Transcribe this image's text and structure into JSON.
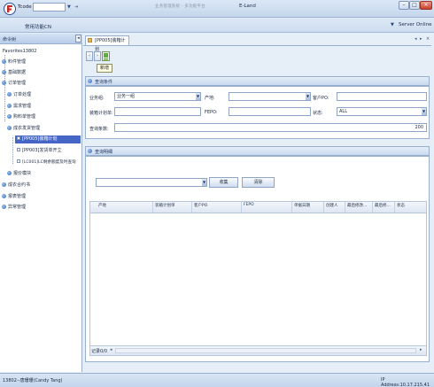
{
  "titlebar": {
    "tcode_label": "Tcode",
    "blurred_title": "业务管理系统 - 多功能平台",
    "app_title": "E-Land",
    "min": "–",
    "max": "□",
    "close": "×"
  },
  "menubar": {
    "favorites_menu": "常用功能CN",
    "server": "Server Online"
  },
  "sidebar": {
    "header": "命令树",
    "items": [
      {
        "label": "Favorites13802",
        "level": 0,
        "icon": "none"
      },
      {
        "label": "料件管理",
        "level": 0,
        "icon": "dot"
      },
      {
        "label": "基础数据",
        "level": 0,
        "icon": "dot"
      },
      {
        "label": "订单管理",
        "level": 0,
        "icon": "dot"
      },
      {
        "label": "订单处理",
        "level": 1,
        "icon": "dot"
      },
      {
        "label": "需求管理",
        "level": 1,
        "icon": "dot"
      },
      {
        "label": "购料单管理",
        "level": 1,
        "icon": "dot"
      },
      {
        "label": "成衣发货管理",
        "level": 1,
        "icon": "dot"
      },
      {
        "label": "[PP005]装箱计划",
        "level": 2,
        "icon": "sq",
        "selected": true
      },
      {
        "label": "[PP003]发货单开立",
        "level": 2,
        "icon": "sq"
      },
      {
        "label": "[LC001]LC剩余额度及时查询",
        "level": 2,
        "icon": "sq"
      },
      {
        "label": "报价模块",
        "level": 1,
        "icon": "dot"
      },
      {
        "label": "成衣合约书",
        "level": 0,
        "icon": "dot"
      },
      {
        "label": "报表管理",
        "level": 0,
        "icon": "dot"
      },
      {
        "label": "异常管理",
        "level": 0,
        "icon": "dot"
      }
    ]
  },
  "tab": {
    "label": "[PP005]装箱计划"
  },
  "toolbar": {
    "tooltip": "新增"
  },
  "search_panel": {
    "title": "查询条件",
    "fields": {
      "business_group_label": "业务组:",
      "business_group_value": "业务一组",
      "origin_label": "产地:",
      "customer_po_label": "客户PO:",
      "packing_plan_label": "装箱计划单:",
      "fepo_label": "FEPO:",
      "status_label": "状态:",
      "status_value": "ALL",
      "query_count_label": "查询条数:",
      "query_count_value": "200"
    }
  },
  "detail_panel": {
    "title": "查询明细",
    "collect_button": "收集",
    "clear_button": "清除",
    "columns": [
      "产地",
      "装箱计划单",
      "客户PO",
      "FEPO",
      "单据日期",
      "创建人",
      "最后修改...",
      "最后修...",
      "状态"
    ],
    "rows": [],
    "record_label": "记录0/0"
  },
  "statusbar": {
    "user": "13802--唐珊珊(Candy Tang)",
    "ip": "IP Address:10.17.215.41"
  }
}
